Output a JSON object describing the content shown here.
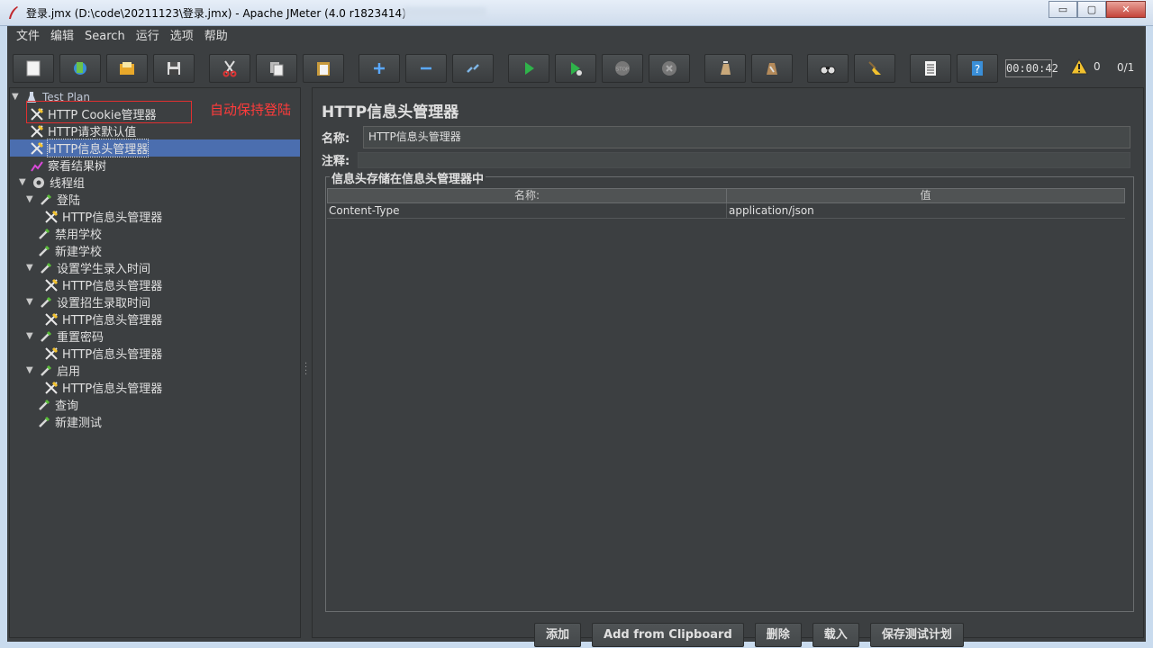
{
  "window": {
    "title": "登录.jmx (D:\\code\\20211123\\登录.jmx) - Apache JMeter (4.0 r1823414)",
    "minimize": "▭",
    "maximize": "▢",
    "close": "✕"
  },
  "menu": [
    "文件",
    "编辑",
    "Search",
    "运行",
    "选项",
    "帮助"
  ],
  "toolbar": {
    "buttons": [
      "new-icon",
      "templates-icon",
      "open-icon",
      "save-icon",
      "cut-icon",
      "copy-icon",
      "paste-icon",
      "expand-icon",
      "collapse-icon",
      "toggle-icon",
      "start-icon",
      "start-no-pause-icon",
      "stop-icon",
      "shutdown-icon",
      "clear-icon",
      "clear-all-icon",
      "search-icon",
      "reset-search-icon",
      "function-helper-icon",
      "help-icon"
    ],
    "timer": "00:00:42",
    "warnings": "0",
    "threads": "0/1"
  },
  "tree": {
    "nodes": [
      {
        "label": "Test Plan"
      },
      {
        "label": "HTTP Cookie管理器"
      },
      {
        "label": "HTTP请求默认值"
      },
      {
        "label": "HTTP信息头管理器"
      },
      {
        "label": "察看结果树"
      },
      {
        "label": "线程组"
      },
      {
        "label": "登陆"
      },
      {
        "label": "HTTP信息头管理器"
      },
      {
        "label": "禁用学校"
      },
      {
        "label": "新建学校"
      },
      {
        "label": "设置学生录入时间"
      },
      {
        "label": "HTTP信息头管理器"
      },
      {
        "label": "设置招生录取时间"
      },
      {
        "label": "HTTP信息头管理器"
      },
      {
        "label": "重置密码"
      },
      {
        "label": "HTTP信息头管理器"
      },
      {
        "label": "启用"
      },
      {
        "label": "HTTP信息头管理器"
      },
      {
        "label": "查询"
      },
      {
        "label": "新建测试"
      }
    ],
    "annotation": "自动保持登陆"
  },
  "panel": {
    "title": "HTTP信息头管理器",
    "name_label": "名称:",
    "name_value": "HTTP信息头管理器",
    "comment_label": "注释:",
    "comment_value": "",
    "group_title": "信息头存储在信息头管理器中",
    "columns": [
      "名称:",
      "值"
    ],
    "rows": [
      {
        "name": "Content-Type",
        "value": "application/json"
      }
    ],
    "buttons": [
      "添加",
      "Add from Clipboard",
      "删除",
      "载入",
      "保存测试计划"
    ]
  },
  "colors": {
    "background": "#3c3f41",
    "selection": "#4b6eaf",
    "annotation": "#ff3b3b"
  }
}
